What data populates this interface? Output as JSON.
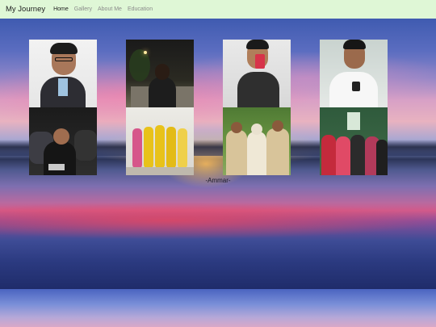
{
  "navbar": {
    "brand": "My Journey",
    "links": [
      {
        "label": "Home",
        "active": true
      },
      {
        "label": "Gallery",
        "active": false
      },
      {
        "label": "About Me",
        "active": false
      },
      {
        "label": "Education",
        "active": false
      }
    ]
  },
  "gallery": {
    "caption": "-Ammar-"
  },
  "colors": {
    "navbar_bg": "#dff7d6",
    "active_link": "#222222",
    "inactive_link": "#8a8a8a"
  }
}
